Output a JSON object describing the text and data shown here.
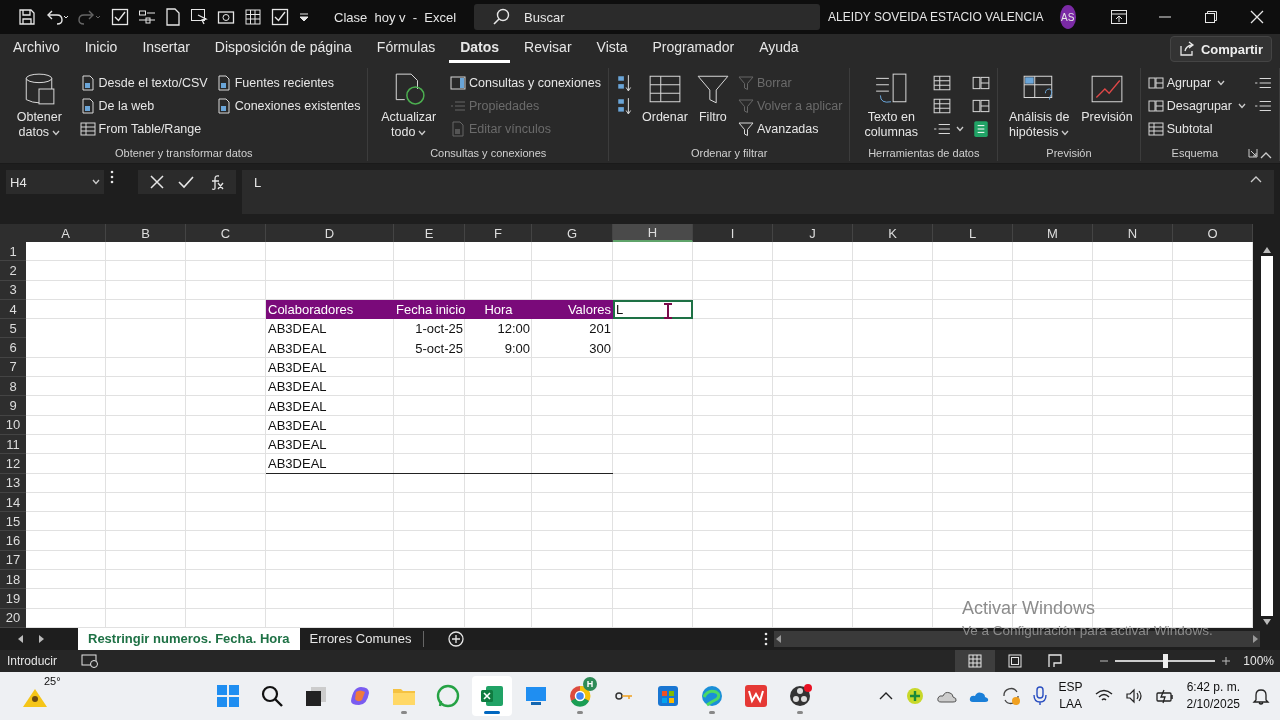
{
  "title_bar": {
    "document_title": "Clase  hoy v  -  Excel",
    "search": {
      "placeholder": "Buscar"
    },
    "user_name": "ALEIDY SOVEIDA ESTACIO VALENCIA",
    "avatar": "AS"
  },
  "menu_tabs": [
    {
      "label": "Archivo",
      "selected": false
    },
    {
      "label": "Inicio",
      "selected": false
    },
    {
      "label": "Insertar",
      "selected": false
    },
    {
      "label": "Disposición de página",
      "selected": false
    },
    {
      "label": "Fórmulas",
      "selected": false
    },
    {
      "label": "Datos",
      "selected": true
    },
    {
      "label": "Revisar",
      "selected": false
    },
    {
      "label": "Vista",
      "selected": false
    },
    {
      "label": "Programador",
      "selected": false
    },
    {
      "label": "Ayuda",
      "selected": false
    }
  ],
  "share_button": "Compartir",
  "ribbon_groups": [
    {
      "label": "Obtener y transformar datos",
      "columns": [
        [
          {
            "kind": "large",
            "label": "Obtener datos",
            "dropdown": true,
            "disabled": false
          }
        ],
        [
          {
            "kind": "small",
            "label": "Desde el texto/CSV",
            "dropdown": false,
            "disabled": false
          },
          {
            "kind": "small",
            "label": "De la web",
            "dropdown": false,
            "disabled": false
          },
          {
            "kind": "small",
            "label": "From Table/Range",
            "dropdown": false,
            "disabled": false
          }
        ],
        [
          {
            "kind": "small",
            "label": "Fuentes recientes",
            "dropdown": false,
            "disabled": false
          },
          {
            "kind": "small",
            "label": "Conexiones existentes",
            "dropdown": false,
            "disabled": false
          }
        ]
      ]
    },
    {
      "label": "Consultas y conexiones",
      "columns": [
        [
          {
            "kind": "large",
            "label": "Actualizar todo",
            "dropdown": true,
            "disabled": false
          }
        ],
        [
          {
            "kind": "small",
            "label": "Consultas y conexiones",
            "dropdown": false,
            "disabled": false
          },
          {
            "kind": "small",
            "label": "Propiedades",
            "dropdown": false,
            "disabled": true
          },
          {
            "kind": "small",
            "label": "Editar vínculos",
            "dropdown": false,
            "disabled": true
          }
        ]
      ]
    },
    {
      "label": "Ordenar y filtrar",
      "columns": [
        [
          {
            "kind": "icon",
            "dropdown": false,
            "disabled": false
          },
          {
            "kind": "icon",
            "dropdown": false,
            "disabled": false
          }
        ],
        [
          {
            "kind": "large",
            "label": "Ordenar",
            "dropdown": false,
            "disabled": false
          }
        ],
        [
          {
            "kind": "large",
            "label": "Filtro",
            "dropdown": false,
            "disabled": false
          }
        ],
        [
          {
            "kind": "small",
            "label": "Borrar",
            "dropdown": false,
            "disabled": true
          },
          {
            "kind": "small",
            "label": "Volver a aplicar",
            "dropdown": false,
            "disabled": true
          },
          {
            "kind": "small",
            "label": "Avanzadas",
            "dropdown": false,
            "disabled": false
          }
        ]
      ]
    },
    {
      "label": "Herramientas de datos",
      "columns": [
        [
          {
            "kind": "large",
            "label": "Texto en columnas",
            "dropdown": false,
            "disabled": false
          }
        ],
        [
          {
            "kind": "icon",
            "dropdown": false,
            "disabled": false
          },
          {
            "kind": "icon",
            "dropdown": false,
            "disabled": false
          },
          {
            "kind": "icon",
            "dropdown": true,
            "disabled": false
          }
        ],
        [
          {
            "kind": "icon",
            "dropdown": false,
            "disabled": false
          },
          {
            "kind": "icon",
            "dropdown": false,
            "disabled": false
          },
          {
            "kind": "icon",
            "dropdown": false,
            "disabled": false
          }
        ]
      ]
    },
    {
      "label": "Previsión",
      "columns": [
        [
          {
            "kind": "large",
            "label": "Análisis de hipótesis",
            "dropdown": true,
            "disabled": false
          }
        ],
        [
          {
            "kind": "large",
            "label": "Previsión",
            "dropdown": false,
            "disabled": false
          }
        ]
      ]
    },
    {
      "label": "Esquema",
      "columns": [
        [
          {
            "kind": "small",
            "label": "Agrupar",
            "dropdown": true,
            "disabled": false
          },
          {
            "kind": "small",
            "label": "Desagrupar",
            "dropdown": true,
            "disabled": false
          },
          {
            "kind": "small",
            "label": "Subtotal",
            "dropdown": false,
            "disabled": false
          }
        ],
        [
          {
            "kind": "icon",
            "dropdown": false,
            "disabled": false
          },
          {
            "kind": "icon",
            "dropdown": false,
            "disabled": false
          }
        ]
      ]
    }
  ],
  "formula_bar": {
    "name_box": "H4",
    "formula": "L"
  },
  "sheet": {
    "columns": [
      {
        "label": "A",
        "selected": false
      },
      {
        "label": "B",
        "selected": false
      },
      {
        "label": "C",
        "selected": false
      },
      {
        "label": "D",
        "selected": false
      },
      {
        "label": "E",
        "selected": false
      },
      {
        "label": "F",
        "selected": false
      },
      {
        "label": "G",
        "selected": false
      },
      {
        "label": "H",
        "selected": true
      },
      {
        "label": "I",
        "selected": false
      },
      {
        "label": "J",
        "selected": false
      },
      {
        "label": "K",
        "selected": false
      },
      {
        "label": "L",
        "selected": false
      },
      {
        "label": "M",
        "selected": false
      },
      {
        "label": "N",
        "selected": false
      },
      {
        "label": "O",
        "selected": false
      }
    ],
    "rows": [
      "1",
      "2",
      "3",
      "4",
      "5",
      "6",
      "7",
      "8",
      "9",
      "10",
      "11",
      "12",
      "13",
      "14",
      "15",
      "16",
      "17",
      "18",
      "19",
      "20"
    ],
    "table": {
      "headers": [
        "Colaboradores",
        "Fecha inicio",
        "Hora",
        "Valores"
      ],
      "rows": [
        [
          "AB3DEAL",
          "1-oct-25",
          "12:00",
          "201"
        ],
        [
          "AB3DEAL",
          "5-oct-25",
          "9:00",
          "300"
        ],
        [
          "AB3DEAL"
        ],
        [
          "AB3DEAL"
        ],
        [
          "AB3DEAL"
        ],
        [
          "AB3DEAL"
        ],
        [
          "AB3DEAL"
        ],
        [
          "AB3DEAL"
        ]
      ]
    },
    "active_cell": "L"
  },
  "sheet_tabs": [
    {
      "label": "Restringir numeros. Fecha. Hora",
      "selected": true
    },
    {
      "label": "Errores Comunes",
      "selected": false
    }
  ],
  "status_bar": {
    "mode": "Introducir",
    "views": [
      {
        "selected": true
      },
      {
        "selected": false
      },
      {
        "selected": false
      }
    ],
    "zoom": {
      "level": 0.5,
      "reading": "100%"
    }
  },
  "activation_notice": {
    "title": "Activar Windows",
    "message": "Ve a Configuración para activar Windows."
  },
  "taskbar": {
    "weather": "25°",
    "apps": [
      {
        "running": false,
        "selected": false
      },
      {
        "running": false,
        "selected": false
      },
      {
        "running": false,
        "selected": false
      },
      {
        "running": false,
        "selected": false
      },
      {
        "running": true,
        "selected": false
      },
      {
        "running": false,
        "selected": false
      },
      {
        "running": true,
        "selected": true
      },
      {
        "running": false,
        "selected": false
      },
      {
        "running": true,
        "selected": false,
        "badge": "H"
      },
      {
        "running": false,
        "selected": false
      },
      {
        "running": false,
        "selected": false
      },
      {
        "running": true,
        "selected": false
      },
      {
        "running": false,
        "selected": false
      },
      {
        "running": true,
        "selected": false
      }
    ],
    "language": [
      "ESP",
      "LAA"
    ],
    "time": "6:42 p. m.",
    "date": "2/10/2025"
  }
}
